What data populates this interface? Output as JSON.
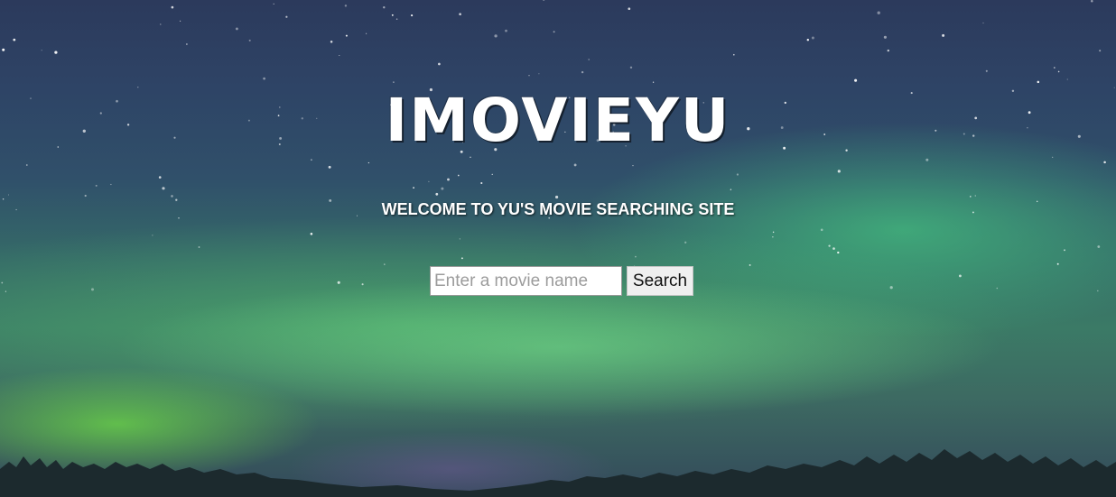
{
  "page": {
    "title": "IMOVIEYU",
    "subtitle": "WELCOME TO YU'S MOVIE SEARCHING SITE"
  },
  "search": {
    "placeholder": "Enter a movie name",
    "value": "",
    "button_label": "Search"
  },
  "colors": {
    "sky_top": "#2c3a5c",
    "aurora_green": "#5fd070",
    "text": "#ffffff",
    "button_bg": "#efefef"
  }
}
